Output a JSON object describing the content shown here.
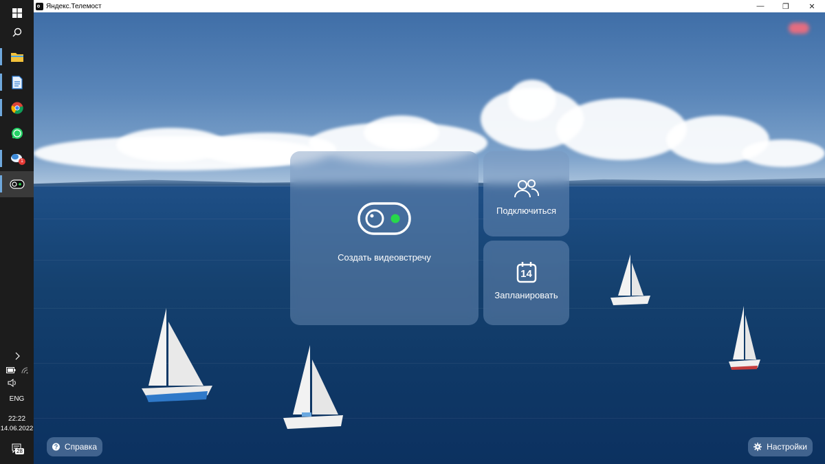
{
  "taskbar": {
    "items": [
      {
        "name": "start",
        "icon": "windows-logo-icon"
      },
      {
        "name": "search",
        "icon": "search-icon"
      },
      {
        "name": "file-explorer",
        "icon": "folder-icon"
      },
      {
        "name": "word-document",
        "icon": "document-icon"
      },
      {
        "name": "chrome",
        "icon": "chrome-icon"
      },
      {
        "name": "whatsapp",
        "icon": "whatsapp-icon"
      },
      {
        "name": "mail",
        "icon": "mail-icon",
        "badge": "1"
      },
      {
        "name": "telemost",
        "icon": "telemost-icon",
        "active": true
      }
    ],
    "tray": {
      "language": "ENG",
      "time": "22:22",
      "date": "14.06.2022",
      "notifications_count": "28"
    }
  },
  "window": {
    "title": "Яндекс.Телемост",
    "controls": {
      "minimize": "—",
      "restore": "❐",
      "close": "✕"
    }
  },
  "actions": {
    "create_meeting": "Создать видеовстречу",
    "join": "Подключиться",
    "schedule": "Запланировать",
    "calendar_day": "14"
  },
  "footer": {
    "help_label": "Справка",
    "settings_label": "Настройки"
  },
  "colors": {
    "accent_green": "#27d84a",
    "panel_glass": "rgba(120,150,190,0.45)"
  }
}
